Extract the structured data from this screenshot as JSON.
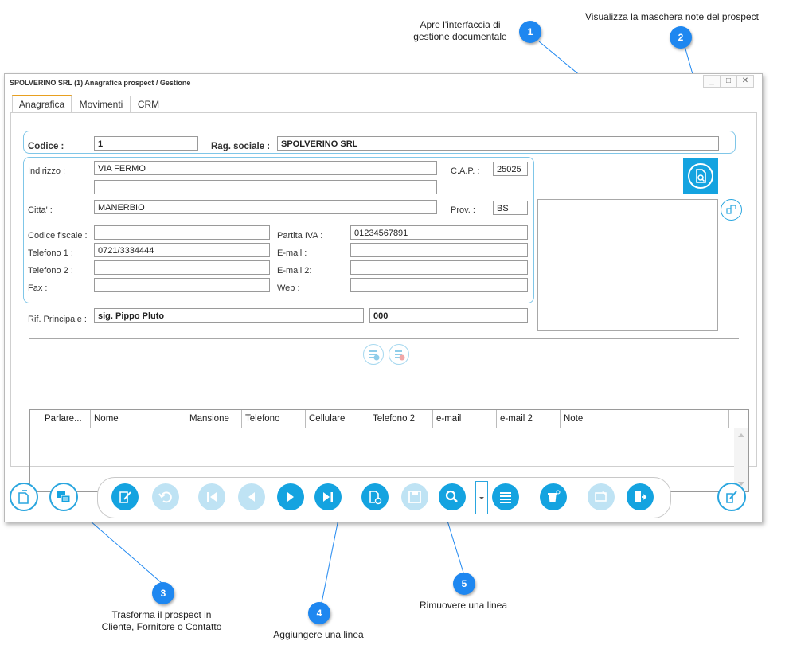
{
  "annotations": {
    "a1": {
      "num": "1",
      "line1": "Apre l'interfaccia di",
      "line2": "gestione documentale"
    },
    "a2": {
      "num": "2",
      "text": "Visualizza la maschera note del prospect"
    },
    "a3": {
      "num": "3",
      "line1": "Trasforma il prospect in",
      "line2": "Cliente, Fornitore o Contatto"
    },
    "a4": {
      "num": "4",
      "text": "Aggiungere una linea"
    },
    "a5": {
      "num": "5",
      "text": "Rimuovere una linea"
    }
  },
  "window": {
    "title": "SPOLVERINO SRL (1) Anagrafica prospect / Gestione",
    "controls": [
      "_",
      "□",
      "✕"
    ]
  },
  "tabs": [
    "Anagrafica",
    "Movimenti",
    "CRM"
  ],
  "form": {
    "codice_label": "Codice :",
    "codice_value": "1",
    "ragsoc_label": "Rag. sociale :",
    "ragsoc_value": "SPOLVERINO SRL",
    "indirizzo_label": "Indirizzo :",
    "indirizzo_value": "VIA FERMO",
    "indirizzo2_value": "",
    "cap_label": "C.A.P. :",
    "cap_value": "25025",
    "citta_label": "Citta' :",
    "citta_value": "MANERBIO",
    "prov_label": "Prov. :",
    "prov_value": "BS",
    "cf_label": "Codice fiscale :",
    "cf_value": "",
    "piva_label": "Partita IVA :",
    "piva_value": "01234567891",
    "tel1_label": "Telefono 1 :",
    "tel1_value": "0721/3334444",
    "email_label": "E-mail :",
    "email_value": "",
    "tel2_label": "Telefono 2 :",
    "tel2_value": "",
    "email2_label": "E-mail 2:",
    "email2_value": "",
    "fax_label": "Fax :",
    "fax_value": "",
    "web_label": "Web :",
    "web_value": "",
    "rif_label": "Rif. Principale :",
    "rif_value": "sig. Pippo Pluto",
    "rif_code": "000"
  },
  "grid": {
    "columns": [
      "Parlare...",
      "Nome",
      "Mansione",
      "Telefono",
      "Cellulare",
      "Telefono 2",
      "e-mail",
      "e-mail 2",
      "Note"
    ],
    "rows": []
  },
  "toolbar_icons": {
    "left": [
      "copy-document-icon",
      "convert-prospect-icon"
    ],
    "main": [
      "edit-icon",
      "undo-icon",
      "first-record-icon",
      "previous-record-icon",
      "next-record-icon",
      "last-record-icon",
      "new-document-icon",
      "save-icon",
      "search-icon",
      "list-icon",
      "delete-icon",
      "cancel-icon",
      "exit-icon"
    ],
    "right": [
      "notes-edit-icon"
    ]
  },
  "colors": {
    "accent": "#14a3e0",
    "disabled": "#bfe3f4",
    "badge": "#1e87f0",
    "callout_line": "#1e87f0",
    "tab_accent": "#e8a020"
  }
}
